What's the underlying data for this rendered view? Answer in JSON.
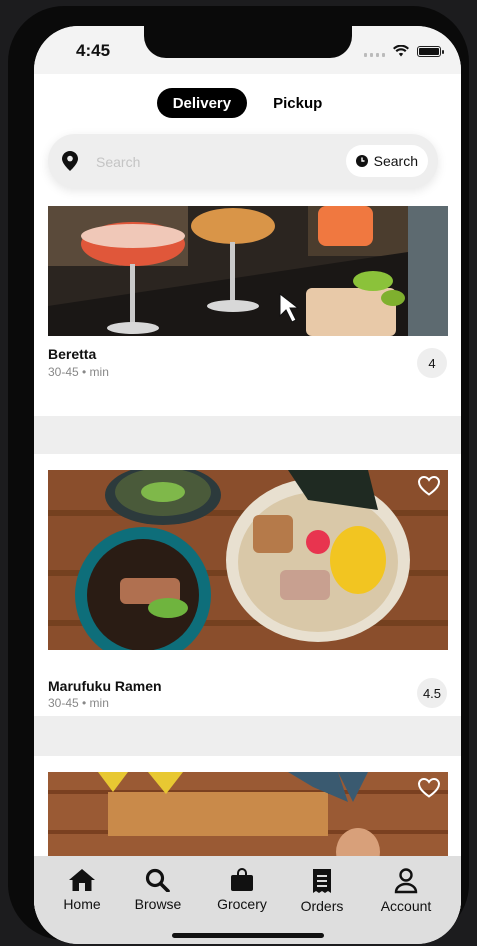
{
  "status_bar": {
    "time": "4:45"
  },
  "mode_toggle": {
    "delivery": "Delivery",
    "pickup": "Pickup"
  },
  "search": {
    "placeholder": "Search",
    "button_label": "Search"
  },
  "restaurants": [
    {
      "name": "Beretta",
      "meta": "30-45 • min",
      "rating": "4"
    },
    {
      "name": "Marufuku Ramen",
      "meta": "30-45 • min",
      "rating": "4.5"
    },
    {
      "name": "",
      "meta": "",
      "rating": ""
    }
  ],
  "tabbar": {
    "items": [
      {
        "label": "Home",
        "icon": "home-icon"
      },
      {
        "label": "Browse",
        "icon": "search-icon"
      },
      {
        "label": "Grocery",
        "icon": "bag-icon"
      },
      {
        "label": "Orders",
        "icon": "receipt-icon"
      },
      {
        "label": "Account",
        "icon": "person-icon"
      }
    ]
  },
  "colors": {
    "accent": "#000000",
    "background": "#ffffff",
    "divider": "#eeeeee",
    "tabbar": "#dedede"
  }
}
